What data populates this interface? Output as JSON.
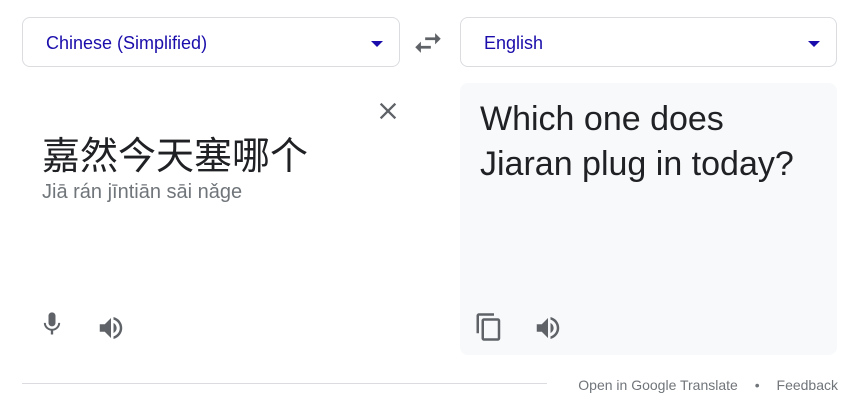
{
  "source_language": {
    "label": "Chinese (Simplified)",
    "icon": "chevron-down-icon"
  },
  "target_language": {
    "label": "English",
    "icon": "chevron-down-icon"
  },
  "swap": {
    "icon": "swap-arrows-icon"
  },
  "source": {
    "text": "嘉然今天塞哪个",
    "transliteration": "Jiā rán jīntiān sāi nǎge",
    "clear_icon": "close-icon",
    "mic_icon": "microphone-icon",
    "speak_icon": "speaker-icon"
  },
  "target": {
    "text": "Which one does Jiaran plug in today?",
    "copy_icon": "copy-icon",
    "speak_icon": "speaker-icon"
  },
  "footer": {
    "open_link": "Open in Google Translate",
    "separator": "•",
    "feedback_link": "Feedback"
  },
  "colors": {
    "link_blue": "#1a0dab",
    "icon_gray": "#5f6368",
    "muted_text": "#70757a",
    "panel_bg": "#f8f9fa",
    "border": "#dadce0"
  }
}
